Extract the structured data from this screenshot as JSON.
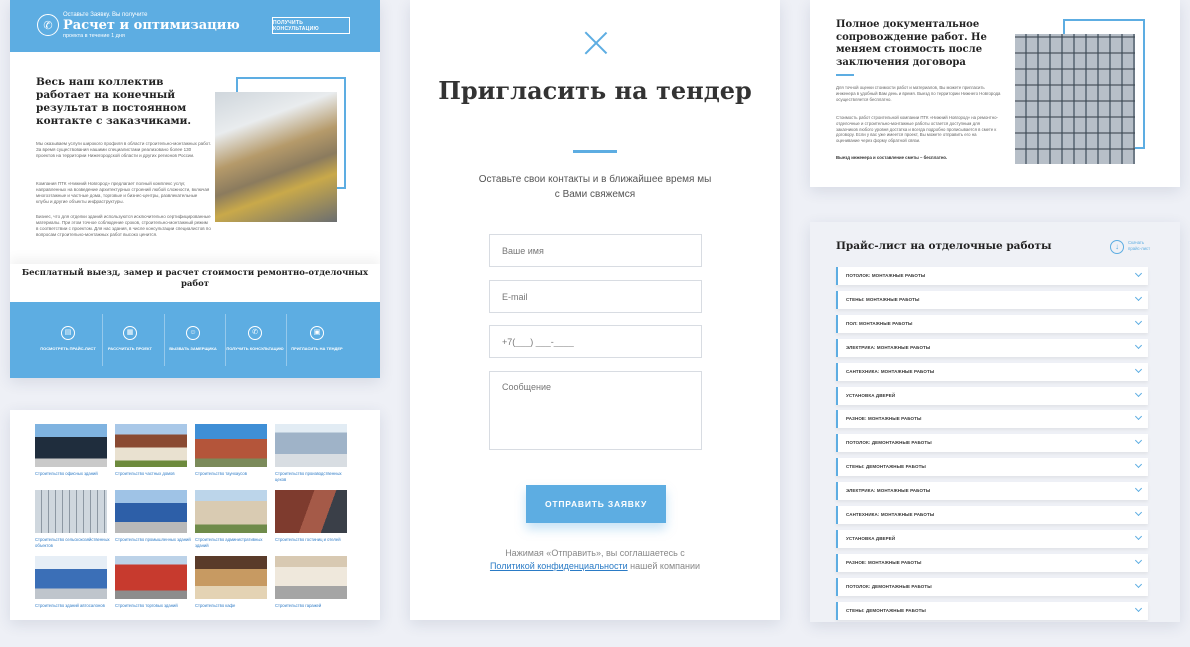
{
  "panel1": {
    "header_sub": "Оставьте Заявку. Вы получите",
    "header_title": "Расчет и оптимизацию",
    "header_sub2": "проекта в течение 1 дня",
    "header_button": "ПОЛУЧИТЬ КОНСУЛЬТАЦИЮ",
    "heading": "Весь наш коллектив работает на конечный результат в постоянном контакте с заказчиками.",
    "paragraphs": [
      "Мы оказываем услуги широкого профиля в области строительно-монтажных работ. За время существования нашими специалистами реализовано более 130 проектов на территории Нижегородской области и других регионов России.",
      "Компания ПТК «Нижний Новгород» предлагает полный комплекс услуг, направленных на возведение архитектурных строений любой сложности, включая многоэтажные и частные дома, торговые и бизнес-центры, развлекательные клубы и другие объекты инфраструктуры.",
      "Бизнес, что для отделки зданий используются исключительно сертифицированные материалы. При этом точное соблюдение сроков, строительно-монтажный режим в соответствии с проектом. Для нас здания, в числе консультации специалистов по вопросам строительно-монтажных работ высоко ценится."
    ],
    "band_title": "Бесплатный выезд, замер и расчет стоимости ремонтно-отделочных работ",
    "actions": [
      "ПОСМОТРЕТЬ ПРАЙС-ЛИСТ",
      "РАССЧИТАТЬ ПРОЕКТ",
      "ВЫЗВАТЬ ЗАМЕРЩИКА",
      "ПОЛУЧИТЬ КОНСУЛЬТАЦИЮ",
      "ПРИГЛАСИТЬ НА ТЕНДЕР"
    ]
  },
  "panel2": {
    "captions": [
      "Строительство офисных зданий",
      "Строительство частных домов",
      "Строительство таунхаусов",
      "Строительство производственных цехов",
      "Строительство сельскохозяйственных объектов",
      "Строительство промышленных зданий",
      "Строительство административных зданий",
      "Строительство гостиниц и отелей",
      "Строительство зданий автосалонов",
      "Строительство торговых зданий",
      "Строительство кафе",
      "Строительство гаражей"
    ]
  },
  "panel3": {
    "title": "Пригласить на тендер",
    "description": "Оставьте свои контакты и в ближайшее время мы с Вами свяжемся",
    "name_placeholder": "Ваше имя",
    "email_placeholder": "E-mail",
    "phone_placeholder": "+7(___) ___-____",
    "message_placeholder": "Сообщение",
    "submit": "ОТПРАВИТЬ ЗАЯВКУ",
    "note_before": "Нажимая «Отправить», вы соглашаетесь с",
    "note_link": "Политикой конфиденциальности",
    "note_after": "нашей компании"
  },
  "panel4": {
    "heading": "Полное документальное сопровождение работ. Не меняем стоимость после заключения договора",
    "paragraphs": [
      "Для точной оценки стоимости работ и материалов, Вы можете пригласить инженера в удобный Вам день и время. Выезд по территории Нижнего Новгорода осуществляется бесплатно.",
      "Стоимость работ строительной компании ПТК «Нижний Новгород» на ремонтно-отделочные и строительно-монтажные работы остается доступным для заказчиков любого уровня достатка и всегда подробно прописывается в смете к договору. Если у вас уже имеется проект, Вы можете отправить его на оценивание через форму обратной связи.",
      "Выезд инженера и составление сметы – бесплатно."
    ]
  },
  "panel5": {
    "title": "Прайс-лист на отделочные работы",
    "download": "Скачать прайс-лист",
    "items": [
      "ПОТОЛОК: МОНТАЖНЫЕ РАБОТЫ",
      "СТЕНЫ: МОНТАЖНЫЕ РАБОТЫ",
      "ПОЛ: МОНТАЖНЫЕ РАБОТЫ",
      "ЭЛЕКТРИКА: МОНТАЖНЫЕ РАБОТЫ",
      "САНТЕХНИКА: МОНТАЖНЫЕ РАБОТЫ",
      "УСТАНОВКА ДВЕРЕЙ",
      "РАЗНОЕ: МОНТАЖНЫЕ РАБОТЫ",
      "ПОТОЛОК: ДЕМОНТАЖНЫЕ РАБОТЫ",
      "СТЕНЫ: ДЕМОНТАЖНЫЕ РАБОТЫ",
      "ЭЛЕКТРИКА: МОНТАЖНЫЕ РАБОТЫ",
      "САНТЕХНИКА: МОНТАЖНЫЕ РАБОТЫ",
      "УСТАНОВКА ДВЕРЕЙ",
      "РАЗНОЕ: МОНТАЖНЫЕ РАБОТЫ",
      "ПОТОЛОК: ДЕМОНТАЖНЫЕ РАБОТЫ",
      "СТЕНЫ: ДЕМОНТАЖНЫЕ РАБОТЫ"
    ]
  },
  "colors": {
    "accent": "#5dade2",
    "link": "#2a7bc6"
  }
}
